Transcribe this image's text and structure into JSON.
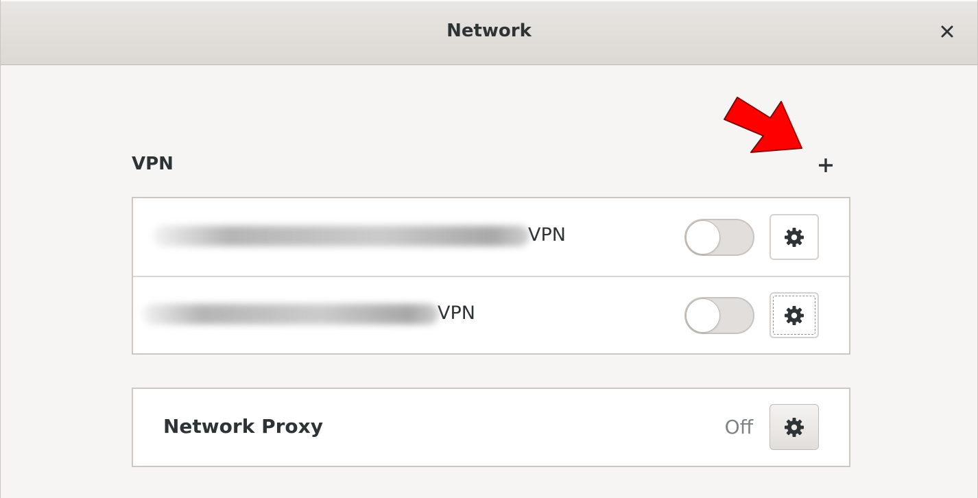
{
  "window": {
    "title": "Network",
    "close_icon": "close-icon"
  },
  "vpn": {
    "section_label": "VPN",
    "add_icon": "plus-icon",
    "connections": [
      {
        "name_suffix": "VPN",
        "enabled": false,
        "settings_icon": "gear-icon"
      },
      {
        "name_suffix": "VPN",
        "enabled": false,
        "settings_icon": "gear-icon"
      }
    ]
  },
  "proxy": {
    "label": "Network Proxy",
    "status": "Off",
    "settings_icon": "gear-icon"
  },
  "annotation": {
    "arrow_color": "#ff0000"
  }
}
